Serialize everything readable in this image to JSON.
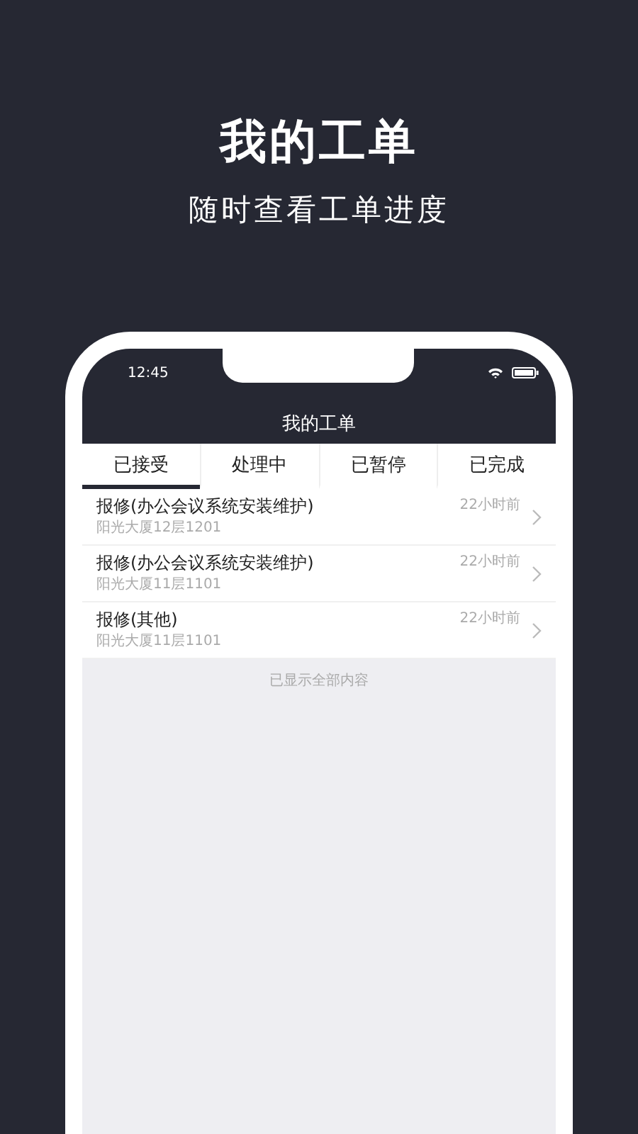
{
  "promo": {
    "title": "我的工单",
    "subtitle": "随时查看工单进度"
  },
  "status_bar": {
    "time": "12:45"
  },
  "header": {
    "title": "我的工单"
  },
  "tabs": [
    {
      "label": "已接受",
      "selected": true
    },
    {
      "label": "处理中",
      "selected": false
    },
    {
      "label": "已暂停",
      "selected": false
    },
    {
      "label": "已完成",
      "selected": false
    }
  ],
  "orders": [
    {
      "title": "报修(办公会议系统安装维护)",
      "location": "阳光大厦12层1201",
      "time": "22小时前"
    },
    {
      "title": "报修(办公会议系统安装维护)",
      "location": "阳光大厦11层1101",
      "time": "22小时前"
    },
    {
      "title": "报修(其他)",
      "location": "阳光大厦11层1101",
      "time": "22小时前"
    }
  ],
  "footer_note": "已显示全部内容"
}
